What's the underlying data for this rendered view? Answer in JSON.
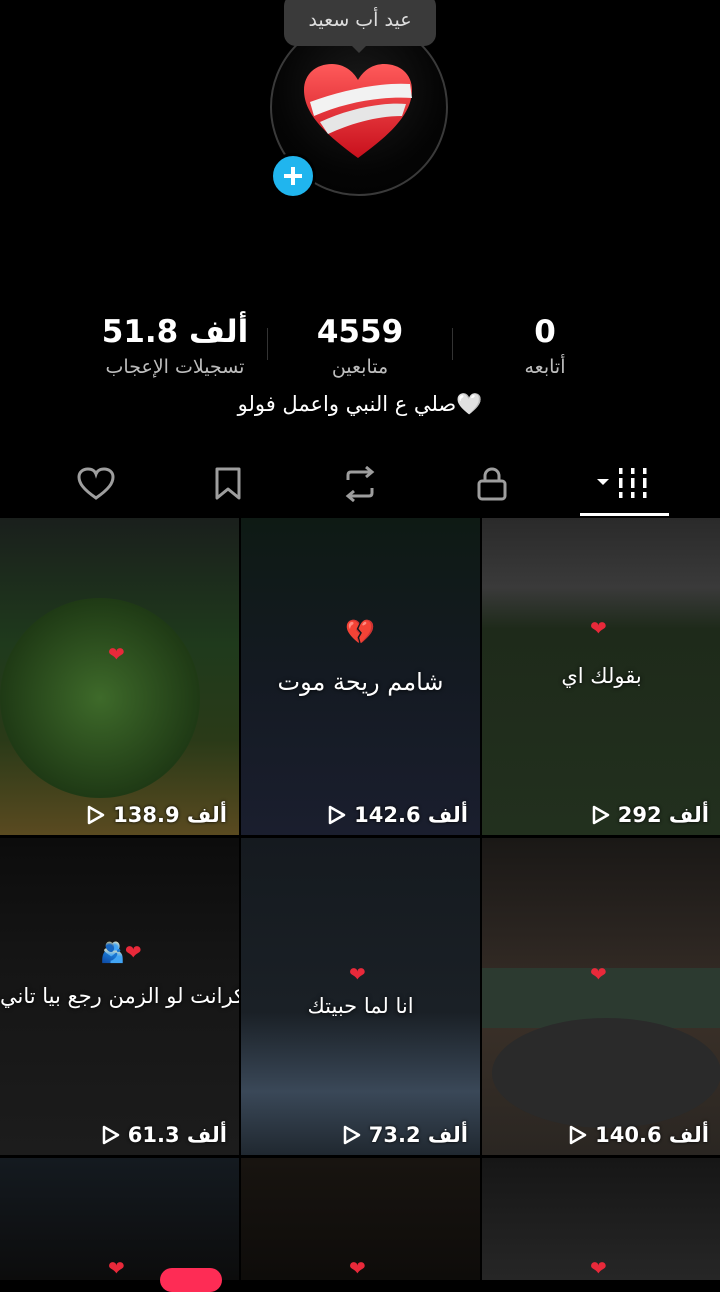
{
  "tooltip": {
    "text": "عيد أب سعيد"
  },
  "stats": [
    {
      "value": "51.8 ألف",
      "label": "تسجيلات الإعجاب"
    },
    {
      "value": "4559",
      "label": "متابعين"
    },
    {
      "value": "0",
      "label": "أتابعه"
    }
  ],
  "bio": "صلي ع النبي واعمل فولو🤍",
  "tabs": [
    {
      "name": "liked-tab",
      "icon": "heart-outline-icon"
    },
    {
      "name": "saved-tab",
      "icon": "bookmark-icon"
    },
    {
      "name": "reposts-tab",
      "icon": "repost-icon"
    },
    {
      "name": "private-tab",
      "icon": "lock-icon"
    },
    {
      "name": "videos-tab",
      "icon": "grid-icon",
      "active": true
    }
  ],
  "videos": [
    {
      "views": "138.9 ألف",
      "caption": "",
      "bg": "#1a2418"
    },
    {
      "views": "142.6 ألف",
      "caption": "شامم ريحة موت",
      "bg": "#121620"
    },
    {
      "views": "292 ألف",
      "caption": "بقولك اي",
      "bg": "#1b2219"
    },
    {
      "views": "61.3 ألف",
      "caption": "متكرانت لو الزمن رجع بيا تاني",
      "bg": "#141414"
    },
    {
      "views": "73.2 ألف",
      "caption": "انا لما حبيتك",
      "bg": "#161a1e"
    },
    {
      "views": "140.6 ألف",
      "caption": "",
      "bg": "#221e1a"
    },
    {
      "views": "",
      "caption": "",
      "bg": "#101418"
    },
    {
      "views": "",
      "caption": "",
      "bg": "#151211"
    },
    {
      "views": "",
      "caption": "",
      "bg": "#131313"
    }
  ],
  "colors": {
    "accent": "#20b5ee",
    "heart": "#e8293a",
    "badge": "#fe2c55"
  }
}
